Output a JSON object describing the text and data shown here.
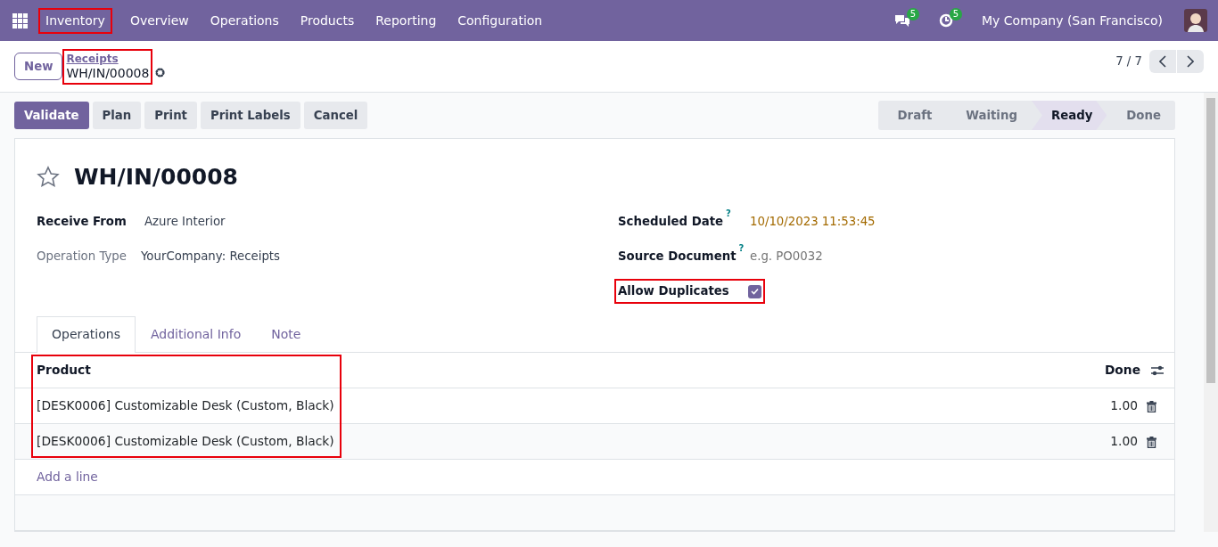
{
  "navbar": {
    "app_name": "Inventory",
    "app_highlighted": true,
    "menu": [
      "Overview",
      "Operations",
      "Products",
      "Reporting",
      "Configuration"
    ],
    "messages_badge": "5",
    "activities_badge": "5",
    "company": "My Company (San Francisco)"
  },
  "control_panel": {
    "new_button": "New",
    "breadcrumb_parent": "Receipts",
    "breadcrumb_current": "WH/IN/00008",
    "breadcrumb_highlighted": true,
    "pager": "7 / 7"
  },
  "actions": [
    {
      "label": "Validate",
      "primary": true
    },
    {
      "label": "Plan",
      "primary": false
    },
    {
      "label": "Print",
      "primary": false
    },
    {
      "label": "Print Labels",
      "primary": false
    },
    {
      "label": "Cancel",
      "primary": false
    }
  ],
  "stages": [
    {
      "label": "Draft",
      "selected": false
    },
    {
      "label": "Waiting",
      "selected": false
    },
    {
      "label": "Ready",
      "selected": true
    },
    {
      "label": "Done",
      "selected": false
    }
  ],
  "record": {
    "title": "WH/IN/00008",
    "starred": false
  },
  "fields_left": [
    {
      "kind": "required",
      "label": "Receive From",
      "value": "Azure Interior"
    },
    {
      "kind": "readonly",
      "label": "Operation Type",
      "value": "YourCompany: Receipts"
    }
  ],
  "fields_right": [
    {
      "kind": "date",
      "label": "Scheduled Date",
      "help": "?",
      "value": "10/10/2023 11:53:45"
    },
    {
      "kind": "text",
      "label": "Source Document",
      "help": "?",
      "placeholder": "e.g. PO0032"
    },
    {
      "kind": "checkbox",
      "label": "Allow Duplicates",
      "checked": true,
      "highlighted": true
    }
  ],
  "tabs": [
    {
      "label": "Operations",
      "selected": true
    },
    {
      "label": "Additional Info",
      "selected": false
    },
    {
      "label": "Note",
      "selected": false
    }
  ],
  "table": {
    "columns": [
      "Product",
      "Done"
    ],
    "product_highlighted": true,
    "rows": [
      {
        "product": "[DESK0006] Customizable Desk (Custom, Black)",
        "done": "1.00"
      },
      {
        "product": "[DESK0006] Customizable Desk (Custom, Black)",
        "done": "1.00"
      }
    ],
    "add_line": "Add a line"
  }
}
